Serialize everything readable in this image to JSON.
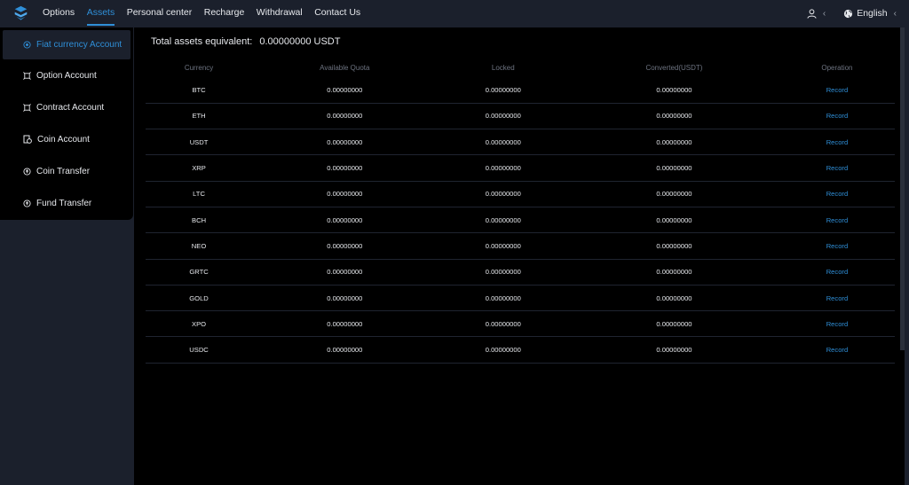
{
  "nav": {
    "items": [
      {
        "label": "Options",
        "active": false
      },
      {
        "label": "Assets",
        "active": true
      },
      {
        "label": "Personal center",
        "active": false
      },
      {
        "label": "Recharge",
        "active": false
      },
      {
        "label": "Withdrawal",
        "active": false
      },
      {
        "label": "Contact Us",
        "active": false
      }
    ],
    "language": "English"
  },
  "sidebar": {
    "items": [
      {
        "label": "Fiat currency Account",
        "icon": "target-icon",
        "active": true
      },
      {
        "label": "Option Account",
        "icon": "option-account-icon",
        "active": false
      },
      {
        "label": "Contract Account",
        "icon": "contract-account-icon",
        "active": false
      },
      {
        "label": "Coin Account",
        "icon": "coin-account-icon",
        "active": false
      },
      {
        "label": "Coin Transfer",
        "icon": "coin-transfer-icon",
        "active": false
      },
      {
        "label": "Fund Transfer",
        "icon": "fund-transfer-icon",
        "active": false
      }
    ]
  },
  "main": {
    "total_label": "Total assets equivalent:",
    "total_value": "0.00000000 USDT",
    "columns": [
      "Currency",
      "Available Quota",
      "Locked",
      "Converted(USDT)",
      "Operation"
    ],
    "rows": [
      {
        "currency": "BTC",
        "available": "0.00000000",
        "locked": "0.00000000",
        "converted": "0.00000000",
        "op": "Record"
      },
      {
        "currency": "ETH",
        "available": "0.00000000",
        "locked": "0.00000000",
        "converted": "0.00000000",
        "op": "Record"
      },
      {
        "currency": "USDT",
        "available": "0.00000000",
        "locked": "0.00000000",
        "converted": "0.00000000",
        "op": "Record"
      },
      {
        "currency": "XRP",
        "available": "0.00000000",
        "locked": "0.00000000",
        "converted": "0.00000000",
        "op": "Record"
      },
      {
        "currency": "LTC",
        "available": "0.00000000",
        "locked": "0.00000000",
        "converted": "0.00000000",
        "op": "Record"
      },
      {
        "currency": "BCH",
        "available": "0.00000000",
        "locked": "0.00000000",
        "converted": "0.00000000",
        "op": "Record"
      },
      {
        "currency": "NEO",
        "available": "0.00000000",
        "locked": "0.00000000",
        "converted": "0.00000000",
        "op": "Record"
      },
      {
        "currency": "GRTC",
        "available": "0.00000000",
        "locked": "0.00000000",
        "converted": "0.00000000",
        "op": "Record"
      },
      {
        "currency": "GOLD",
        "available": "0.00000000",
        "locked": "0.00000000",
        "converted": "0.00000000",
        "op": "Record"
      },
      {
        "currency": "XPO",
        "available": "0.00000000",
        "locked": "0.00000000",
        "converted": "0.00000000",
        "op": "Record"
      },
      {
        "currency": "USDC",
        "available": "0.00000000",
        "locked": "0.00000000",
        "converted": "0.00000000",
        "op": "Record"
      }
    ]
  },
  "colors": {
    "background": "#1b202c",
    "panel": "#000000",
    "accent": "#2f8fd8",
    "text": "#e6e8ec",
    "muted": "#6d7380"
  }
}
